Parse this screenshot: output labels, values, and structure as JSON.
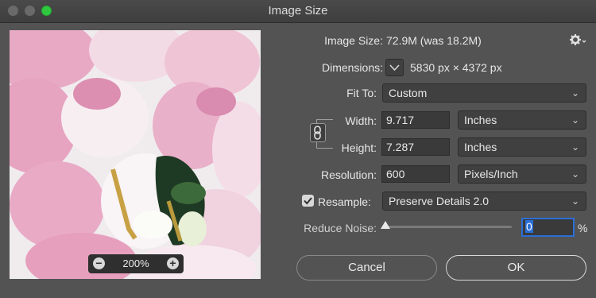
{
  "window": {
    "title": "Image Size"
  },
  "preview": {
    "zoom": "200%",
    "zoom_out_glyph": "−",
    "zoom_in_glyph": "+"
  },
  "info": {
    "image_size_label": "Image Size:",
    "image_size_value": "72.9M (was 18.2M)",
    "dimensions_label": "Dimensions:",
    "dimensions_value": "5830 px  ×  4372 px"
  },
  "fit_to": {
    "label": "Fit To:",
    "value": "Custom"
  },
  "width": {
    "label": "Width:",
    "value": "9.717",
    "unit": "Inches"
  },
  "height": {
    "label": "Height:",
    "value": "7.287",
    "unit": "Inches"
  },
  "resolution": {
    "label": "Resolution:",
    "value": "600",
    "unit": "Pixels/Inch"
  },
  "resample": {
    "label": "Resample:",
    "checked": true,
    "value": "Preserve Details 2.0"
  },
  "reduce_noise": {
    "label": "Reduce Noise:",
    "value": "0",
    "unit": "%"
  },
  "buttons": {
    "cancel": "Cancel",
    "ok": "OK"
  },
  "colors": {
    "accent": "#2a6fd6",
    "bg": "#535353"
  },
  "icons": {
    "settings": "gear-icon",
    "chain": "chain-link-icon",
    "dropdown": "chevron-down-icon"
  }
}
